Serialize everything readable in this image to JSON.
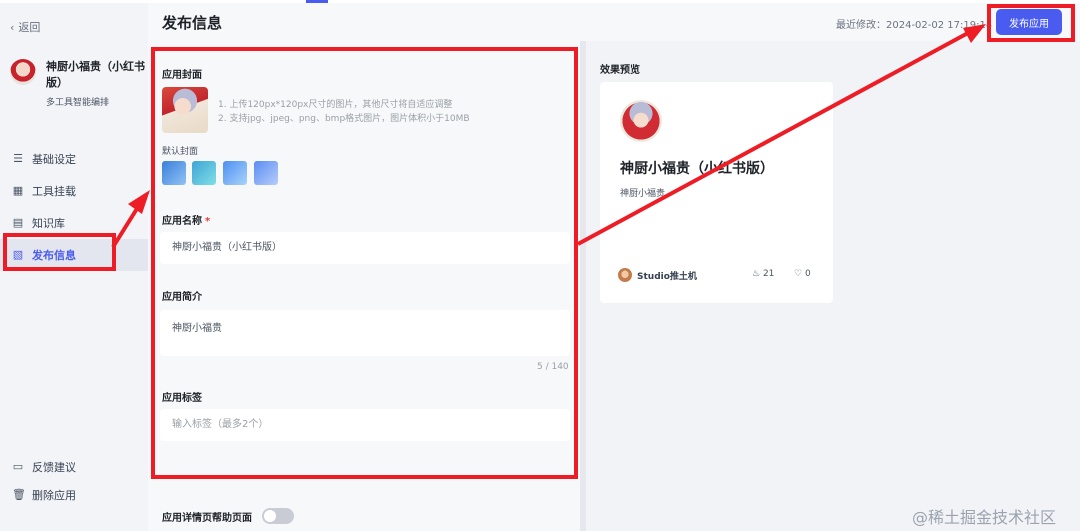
{
  "sidebar": {
    "back_label": "返回",
    "app": {
      "name": "神厨小福贵（小红书版）",
      "desc": "多工具智能编排"
    },
    "nav": [
      {
        "label": "基础设定",
        "icon": "sliders-icon"
      },
      {
        "label": "工具挂载",
        "icon": "grid-icon"
      },
      {
        "label": "知识库",
        "icon": "book-icon"
      },
      {
        "label": "发布信息",
        "icon": "publish-doc-icon",
        "active": true
      }
    ],
    "bottom": [
      {
        "label": "反馈建议",
        "icon": "feedback-icon"
      },
      {
        "label": "删除应用",
        "icon": "trash-icon"
      }
    ]
  },
  "header": {
    "title": "发布信息",
    "last_modified": "最近修改：2024-02-02 17:19:14",
    "publish_label": "发布应用"
  },
  "form": {
    "cover": {
      "label": "应用封面",
      "hint_1": "1. 上传120px*120px尺寸的图片，其他尺寸将自适应调整",
      "hint_2": "2. 支持jpg、jpeg、png、bmp格式图片，图片体积小于10MB",
      "default_label": "默认封面"
    },
    "name": {
      "label": "应用名称",
      "required_mark": "*",
      "value": "神厨小福贵（小红书版）"
    },
    "intro": {
      "label": "应用简介",
      "value": "神厨小福贵",
      "counter": "5 / 140"
    },
    "tags": {
      "label": "应用标签",
      "placeholder": "输入标签（最多2个）"
    },
    "help": {
      "label": "应用详情页帮助页面",
      "enabled": false
    }
  },
  "preview": {
    "label": "效果预览",
    "title": "神厨小福贵（小红书版）",
    "desc": "神厨小福贵",
    "author": "Studio推土机",
    "heat": "21",
    "likes": "0"
  },
  "colors": {
    "accent": "#4a5cf0",
    "annotation_red": "#ee1c25"
  },
  "watermark": "@稀土掘金技术社区"
}
